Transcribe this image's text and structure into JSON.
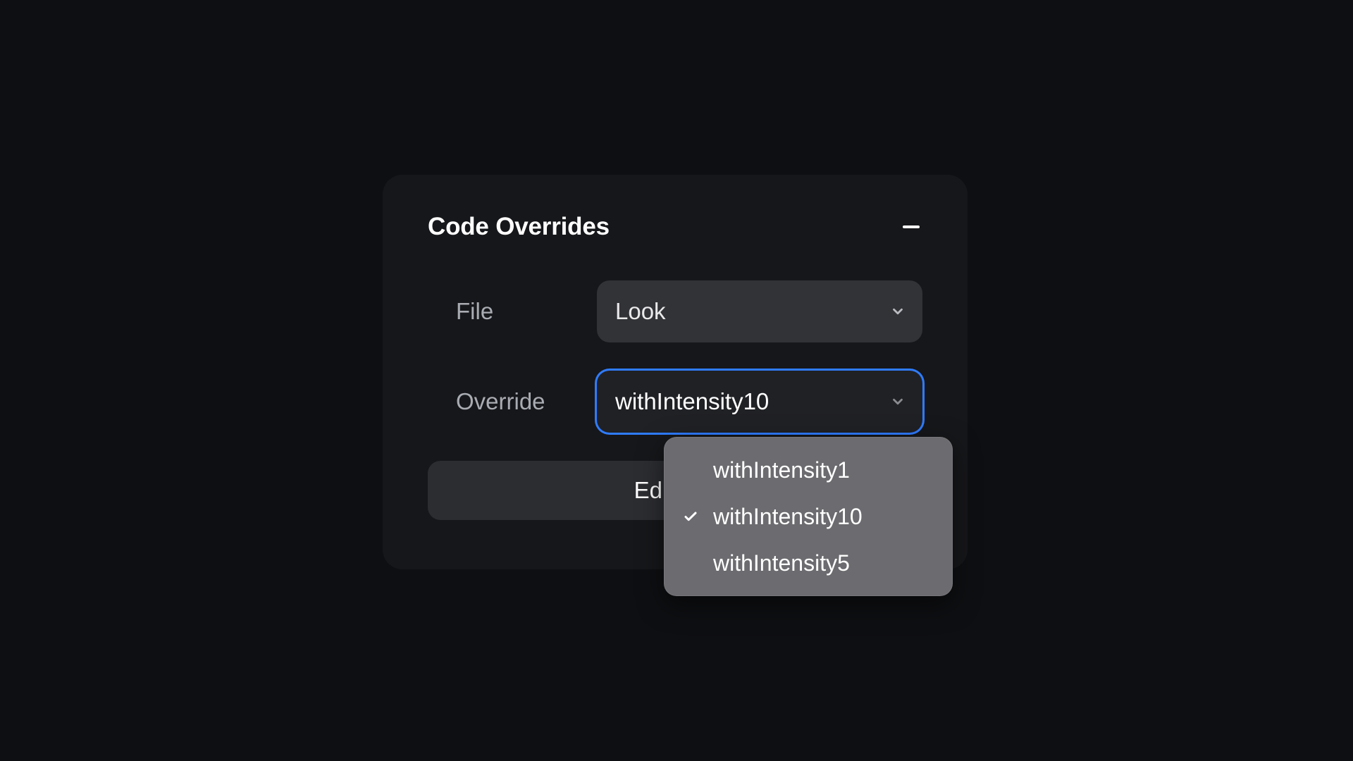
{
  "panel": {
    "title": "Code Overrides",
    "rows": {
      "file": {
        "label": "File",
        "value": "Look"
      },
      "override": {
        "label": "Override",
        "value": "withIntensity10"
      }
    },
    "editLabel": "Edit"
  },
  "dropdown": {
    "options": [
      {
        "label": "withIntensity1",
        "selected": false
      },
      {
        "label": "withIntensity10",
        "selected": true
      },
      {
        "label": "withIntensity5",
        "selected": false
      }
    ]
  },
  "colors": {
    "accent": "#2f7cff",
    "background": "#0e0f12",
    "panel": "#16171a",
    "selectBg": "#323337",
    "dropdownBg": "#6c6c70"
  }
}
